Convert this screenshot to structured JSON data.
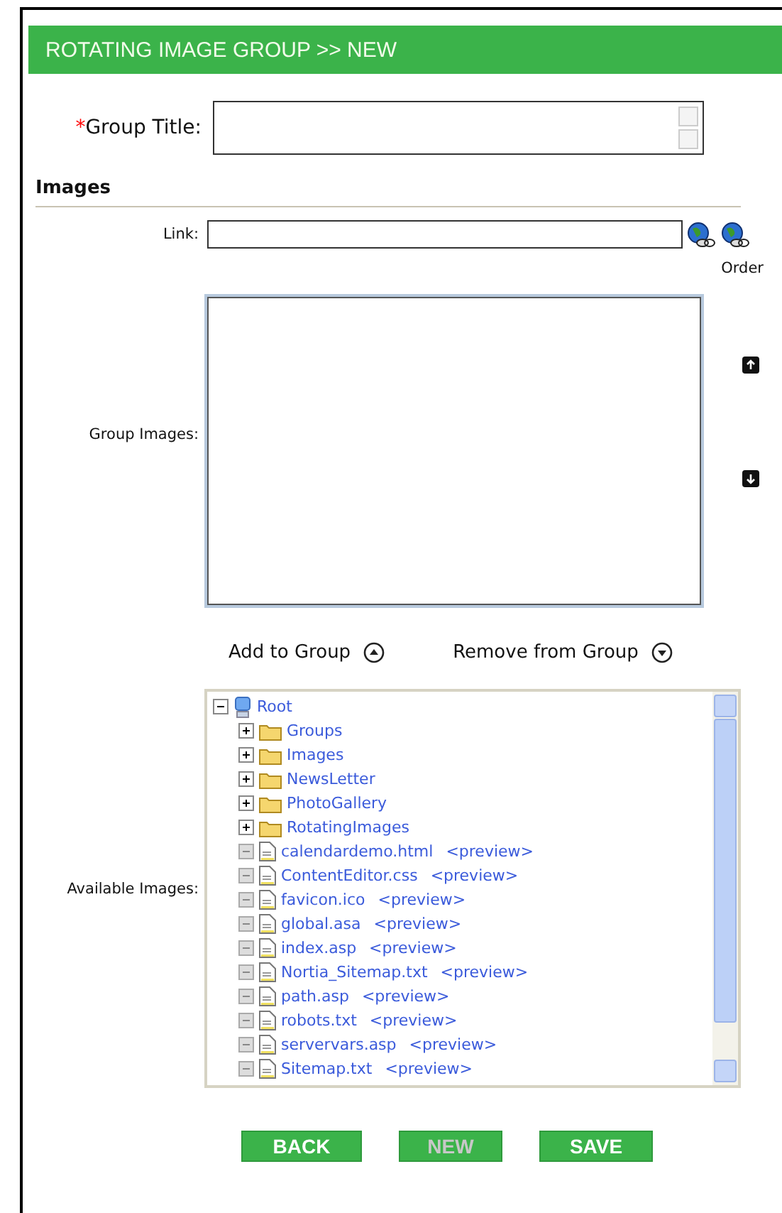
{
  "header": {
    "title": "ROTATING IMAGE GROUP >> NEW"
  },
  "group_title": {
    "required_mark": "*",
    "label": "Group Title:"
  },
  "images_section": {
    "title": "Images"
  },
  "link": {
    "label": "Link:"
  },
  "group_images": {
    "label": "Group Images:",
    "order_label": "Order"
  },
  "move_actions": [
    {
      "label": "Add to Group",
      "kind": "up"
    },
    {
      "label": "Remove from Group",
      "kind": "down"
    }
  ],
  "available_images": {
    "label": "Available Images:",
    "root": {
      "label": "Root",
      "expanded": true,
      "children": [
        {
          "kind": "folder",
          "label": "Groups",
          "expanded": false
        },
        {
          "kind": "folder",
          "label": "Images",
          "expanded": false
        },
        {
          "kind": "folder",
          "label": "NewsLetter",
          "expanded": false
        },
        {
          "kind": "folder",
          "label": "PhotoGallery",
          "expanded": false
        },
        {
          "kind": "folder",
          "label": "RotatingImages",
          "expanded": false
        },
        {
          "kind": "file",
          "label": "calendardemo.html",
          "preview": "<preview>"
        },
        {
          "kind": "file",
          "label": "ContentEditor.css",
          "preview": "<preview>"
        },
        {
          "kind": "file",
          "label": "favicon.ico",
          "preview": "<preview>"
        },
        {
          "kind": "file",
          "label": "global.asa",
          "preview": "<preview>"
        },
        {
          "kind": "file",
          "label": "index.asp",
          "preview": "<preview>"
        },
        {
          "kind": "file",
          "label": "Nortia_Sitemap.txt",
          "preview": "<preview>"
        },
        {
          "kind": "file",
          "label": "path.asp",
          "preview": "<preview>"
        },
        {
          "kind": "file",
          "label": "robots.txt",
          "preview": "<preview>"
        },
        {
          "kind": "file",
          "label": "servervars.asp",
          "preview": "<preview>"
        },
        {
          "kind": "file",
          "label": "Sitemap.txt",
          "preview": "<preview>"
        }
      ]
    }
  },
  "buttons": [
    {
      "label": "BACK",
      "disabled": false
    },
    {
      "label": "NEW",
      "disabled": true
    },
    {
      "label": "SAVE",
      "disabled": false
    }
  ]
}
